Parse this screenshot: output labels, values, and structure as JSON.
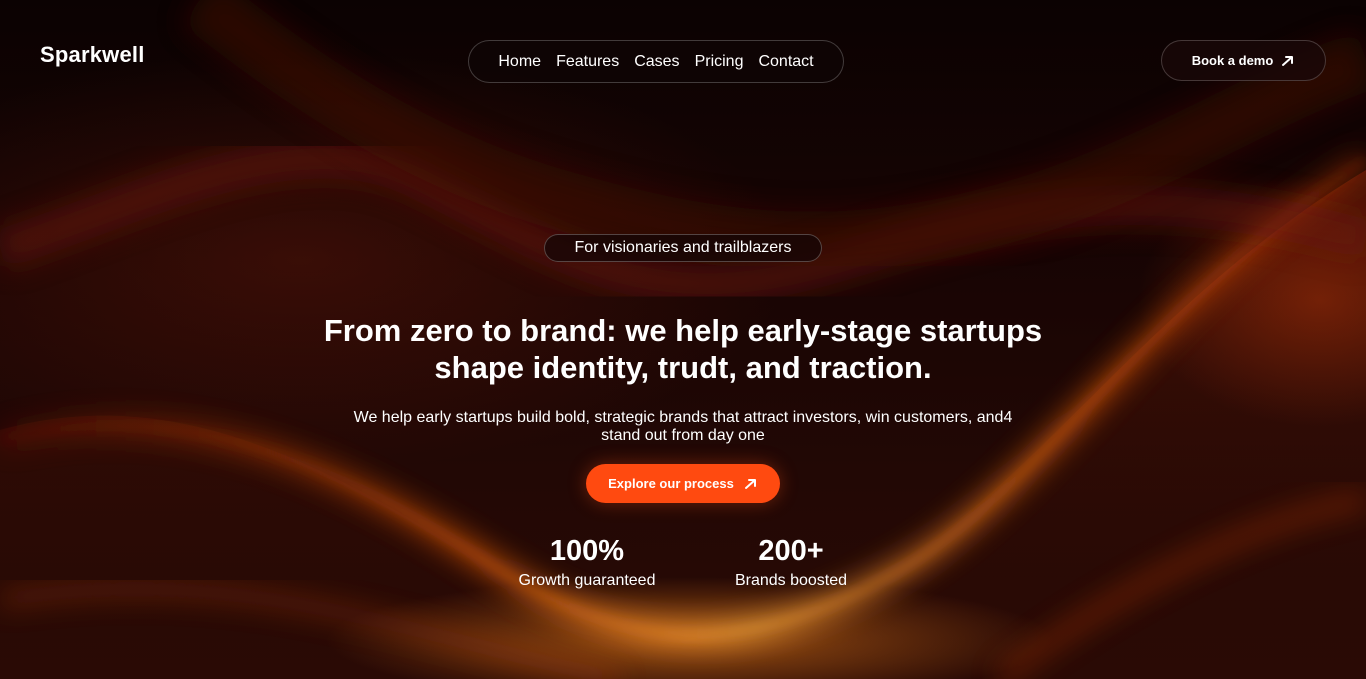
{
  "brand": {
    "name": "Sparkwell"
  },
  "nav": {
    "items": [
      {
        "label": "Home"
      },
      {
        "label": "Features"
      },
      {
        "label": "Cases"
      },
      {
        "label": "Pricing"
      },
      {
        "label": "Contact"
      }
    ]
  },
  "header": {
    "demo_label": "Book a demo",
    "demo_icon": "arrow-up-right-icon"
  },
  "hero": {
    "tagline": "For visionaries and trailblazers",
    "headline_line1": "From zero to brand: we help early-stage startups",
    "headline_line2": "shape identity, trudt, and traction.",
    "subtext_line1": "We help early startups build bold, strategic brands that attract investors, win customers, and4",
    "subtext_line2": "stand out from day one",
    "cta_label": "Explore our process",
    "cta_icon": "arrow-up-right-icon"
  },
  "stats": [
    {
      "value": "100%",
      "label": "Growth guaranteed"
    },
    {
      "value": "200+",
      "label": "Brands boosted"
    }
  ],
  "colors": {
    "accent": "#ff4a10",
    "background": "#0a0303",
    "glow": "#ff8a1e"
  }
}
